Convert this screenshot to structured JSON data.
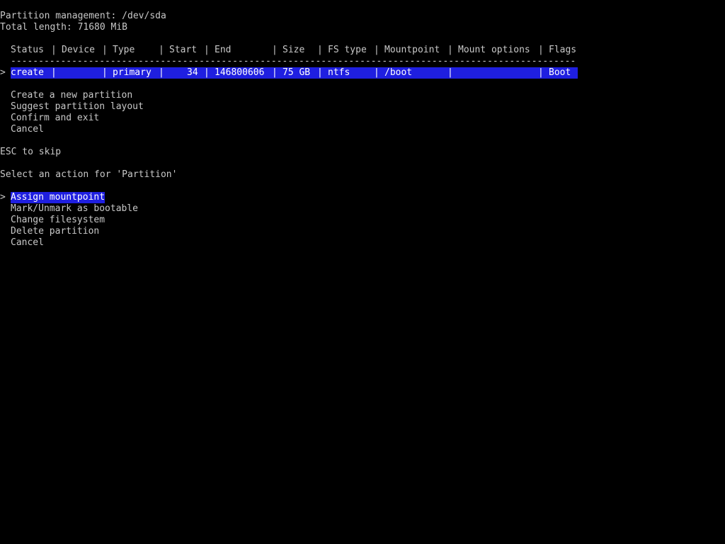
{
  "header": {
    "title": "Partition management: /dev/sda",
    "total_length": "Total length: 71680 MiB"
  },
  "table": {
    "separator": "|",
    "columns": [
      "Status",
      "Device",
      "Type",
      "Start",
      "End",
      "Size",
      "FS type",
      "Mountpoint",
      "Mount options",
      "Flags"
    ],
    "divider": "------------------------------------------------------------------------------------------------------",
    "rows": [
      {
        "cursor": ">",
        "status": "create",
        "device": "",
        "type": "primary",
        "start": "34",
        "end": "146800606",
        "size": "75 GB",
        "fs_type": "ntfs",
        "mountpoint": "/boot",
        "mount_options": "",
        "flags": "Boot",
        "selected": true
      }
    ]
  },
  "main_menu": {
    "items": [
      "Create a new partition",
      "Suggest partition layout",
      "Confirm and exit",
      "Cancel"
    ]
  },
  "hint": "ESC to skip",
  "prompt": "Select an action for 'Partition'",
  "action_menu": {
    "cursor": ">",
    "items": [
      "Assign mountpoint",
      "Mark/Unmark as bootable",
      "Change filesystem",
      "Delete partition",
      "Cancel"
    ],
    "selected_index": 0
  },
  "colors": {
    "background": "#000000",
    "text": "#c8c8c8",
    "selection": "#1f1fe0",
    "selection_text": "#ffffff"
  }
}
